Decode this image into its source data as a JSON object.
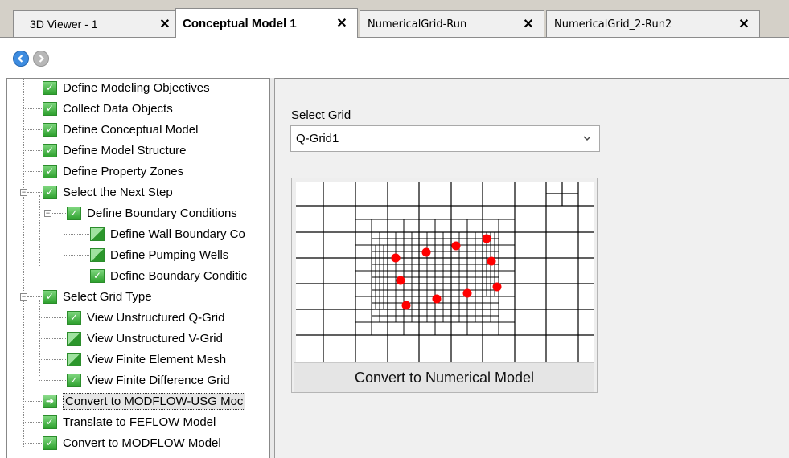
{
  "tabs": [
    {
      "label": "3D Viewer - 1",
      "active": false
    },
    {
      "label": "Conceptual Model 1",
      "active": true
    },
    {
      "label": "NumericalGrid-Run",
      "active": false
    },
    {
      "label": "NumericalGrid_2-Run2",
      "active": false
    }
  ],
  "tab_close_glyph": "✕",
  "nav": {
    "back_icon": "back-arrow-icon",
    "forward_icon": "forward-arrow-icon"
  },
  "tree": {
    "items": [
      {
        "label": "Define Modeling Objectives",
        "state": "done"
      },
      {
        "label": "Collect Data Objects",
        "state": "done"
      },
      {
        "label": "Define  Conceptual Model",
        "state": "done"
      },
      {
        "label": "Define  Model Structure",
        "state": "done"
      },
      {
        "label": "Define  Property Zones",
        "state": "done"
      },
      {
        "label": "Select the Next Step",
        "state": "done"
      },
      {
        "label": "Define Boundary Conditions",
        "state": "done"
      },
      {
        "label": "Define Wall Boundary Co",
        "state": "partial"
      },
      {
        "label": "Define Pumping Wells",
        "state": "partial"
      },
      {
        "label": "Define Boundary Conditic",
        "state": "done"
      },
      {
        "label": "Select Grid Type",
        "state": "done"
      },
      {
        "label": "View Unstructured Q-Grid",
        "state": "done"
      },
      {
        "label": "View Unstructured V-Grid",
        "state": "partial"
      },
      {
        "label": "View Finite Element Mesh",
        "state": "partial"
      },
      {
        "label": "View Finite Difference Grid",
        "state": "done"
      },
      {
        "label": "Convert to MODFLOW-USG Moc",
        "state": "current"
      },
      {
        "label": "Translate to FEFLOW Model",
        "state": "done"
      },
      {
        "label": "Convert to MODFLOW Model",
        "state": "done"
      }
    ]
  },
  "grid_panel": {
    "select_label": "Select Grid",
    "selected_grid": "Q-Grid1",
    "convert_button": "Convert to Numerical Model"
  },
  "colors": {
    "accent": "#3d8ce0",
    "check_green": "#2fa12f",
    "well_red": "#ff0000"
  }
}
